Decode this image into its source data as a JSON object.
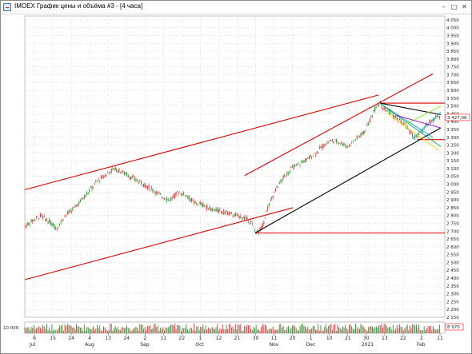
{
  "window": {
    "title": "IMOEX График цены и объёма #3 - [4 часа]",
    "buttons": {
      "minimize": "–",
      "maximize": "□",
      "close": "✕"
    },
    "icon": "chart-window-icon"
  },
  "colors": {
    "up_candle": "#2f8f2f",
    "down_candle": "#d23c3c",
    "trend_red": "#e00000",
    "trend_black": "#000000",
    "price_badge": "#ff3333",
    "volume_badge": "#ff3333",
    "grid": "#c8c8c8"
  },
  "price_label": "3 427,06",
  "volume_label": "8 970",
  "volume_axis_label": "10 000",
  "chart_data": {
    "type": "candlestick",
    "title": "",
    "price_axis": {
      "ylim": [
        2150,
        4075
      ],
      "ticks": [
        4050,
        4000,
        3950,
        3900,
        3850,
        3800,
        3750,
        3700,
        3650,
        3600,
        3550,
        3500,
        3450,
        3400,
        3350,
        3300,
        3250,
        3200,
        3150,
        3100,
        3050,
        3000,
        2950,
        2900,
        2850,
        2800,
        2750,
        2700,
        2650,
        2600,
        2550,
        2500,
        2450,
        2400,
        2350,
        2300,
        2250,
        2200,
        2150
      ],
      "tick_labels": [
        "4 050",
        "4 000",
        "3 950",
        "3 900",
        "3 850",
        "3 800",
        "3 750",
        "3 700",
        "3 650",
        "3 600",
        "3 550",
        "3 500",
        "3 450",
        "3 400",
        "3 350",
        "3 300",
        "3 250",
        "3 200",
        "3 150",
        "3 100",
        "3 050",
        "3 000",
        "2 950",
        "2 900",
        "2 850",
        "2 800",
        "2 750",
        "2 700",
        "2 650",
        "2 600",
        "2 550",
        "2 500",
        "2 450",
        "2 400",
        "2 350",
        "2 300",
        "2 250",
        "2 200",
        "2 150"
      ]
    },
    "grid": true,
    "date_ticks": [
      {
        "day": "6",
        "month": "Jul"
      },
      {
        "day": "15",
        "month": ""
      },
      {
        "day": "24",
        "month": ""
      },
      {
        "day": "4",
        "month": "Aug"
      },
      {
        "day": "13",
        "month": ""
      },
      {
        "day": "24",
        "month": ""
      },
      {
        "day": "2",
        "month": "Sep"
      },
      {
        "day": "11",
        "month": ""
      },
      {
        "day": "22",
        "month": ""
      },
      {
        "day": "1",
        "month": "Oct"
      },
      {
        "day": "12",
        "month": ""
      },
      {
        "day": "21",
        "month": ""
      },
      {
        "day": "30",
        "month": ""
      },
      {
        "day": "11",
        "month": "Nov"
      },
      {
        "day": "20",
        "month": ""
      },
      {
        "day": "1",
        "month": "Dec"
      },
      {
        "day": "10",
        "month": ""
      },
      {
        "day": "21",
        "month": ""
      },
      {
        "day": "30",
        "month": "2021"
      },
      {
        "day": "13",
        "month": ""
      },
      {
        "day": "22",
        "month": ""
      },
      {
        "day": "2",
        "month": "Feb"
      },
      {
        "day": "11",
        "month": ""
      }
    ],
    "price_path": [
      [
        0,
        2730
      ],
      [
        10,
        2770
      ],
      [
        20,
        2800
      ],
      [
        30,
        2760
      ],
      [
        40,
        2720
      ],
      [
        50,
        2800
      ],
      [
        60,
        2840
      ],
      [
        70,
        2900
      ],
      [
        80,
        2960
      ],
      [
        90,
        3020
      ],
      [
        100,
        3060
      ],
      [
        110,
        3100
      ],
      [
        120,
        3080
      ],
      [
        130,
        3050
      ],
      [
        140,
        3020
      ],
      [
        150,
        2990
      ],
      [
        160,
        2960
      ],
      [
        170,
        2920
      ],
      [
        180,
        2900
      ],
      [
        190,
        2950
      ],
      [
        200,
        2930
      ],
      [
        210,
        2880
      ],
      [
        220,
        2870
      ],
      [
        230,
        2840
      ],
      [
        240,
        2830
      ],
      [
        250,
        2820
      ],
      [
        260,
        2800
      ],
      [
        270,
        2790
      ],
      [
        280,
        2760
      ],
      [
        285,
        2700
      ],
      [
        290,
        2700
      ],
      [
        295,
        2740
      ],
      [
        300,
        2840
      ],
      [
        310,
        2960
      ],
      [
        320,
        3040
      ],
      [
        330,
        3100
      ],
      [
        340,
        3130
      ],
      [
        350,
        3160
      ],
      [
        360,
        3200
      ],
      [
        370,
        3250
      ],
      [
        380,
        3280
      ],
      [
        390,
        3270
      ],
      [
        400,
        3240
      ],
      [
        410,
        3290
      ],
      [
        420,
        3330
      ],
      [
        425,
        3380
      ],
      [
        430,
        3440
      ],
      [
        435,
        3500
      ],
      [
        440,
        3520
      ],
      [
        445,
        3480
      ],
      [
        450,
        3470
      ],
      [
        455,
        3440
      ],
      [
        460,
        3420
      ],
      [
        465,
        3400
      ],
      [
        470,
        3380
      ],
      [
        475,
        3350
      ],
      [
        480,
        3310
      ],
      [
        485,
        3300
      ],
      [
        490,
        3330
      ],
      [
        495,
        3360
      ],
      [
        500,
        3390
      ],
      [
        505,
        3410
      ],
      [
        510,
        3430
      ],
      [
        515,
        3427
      ]
    ],
    "lines": [
      {
        "name": "",
        "color": "trend_red",
        "points": [
          [
            0,
            2965
          ],
          [
            438,
            3570
          ]
        ]
      },
      {
        "name": "",
        "color": "trend_red",
        "points": [
          [
            0,
            2390
          ],
          [
            332,
            2850
          ]
        ]
      },
      {
        "name": "",
        "color": "trend_red",
        "points": [
          [
            272,
            3055
          ],
          [
            505,
            3705
          ]
        ]
      },
      {
        "name": "",
        "color": "trend_red",
        "points": [
          [
            285,
            2688
          ],
          [
            520,
            2688
          ]
        ]
      },
      {
        "name": "",
        "color": "trend_red",
        "points": [
          [
            440,
            3518
          ],
          [
            520,
            3518
          ]
        ]
      },
      {
        "name": "",
        "color": "trend_red",
        "points": [
          [
            486,
            3285
          ],
          [
            520,
            3285
          ]
        ]
      },
      {
        "name": "",
        "color": "trend_black",
        "points": [
          [
            285,
            2688
          ],
          [
            515,
            3360
          ]
        ]
      },
      {
        "name": "",
        "color": "trend_black",
        "points": [
          [
            440,
            3518
          ],
          [
            515,
            3445
          ]
        ]
      }
    ]
  }
}
